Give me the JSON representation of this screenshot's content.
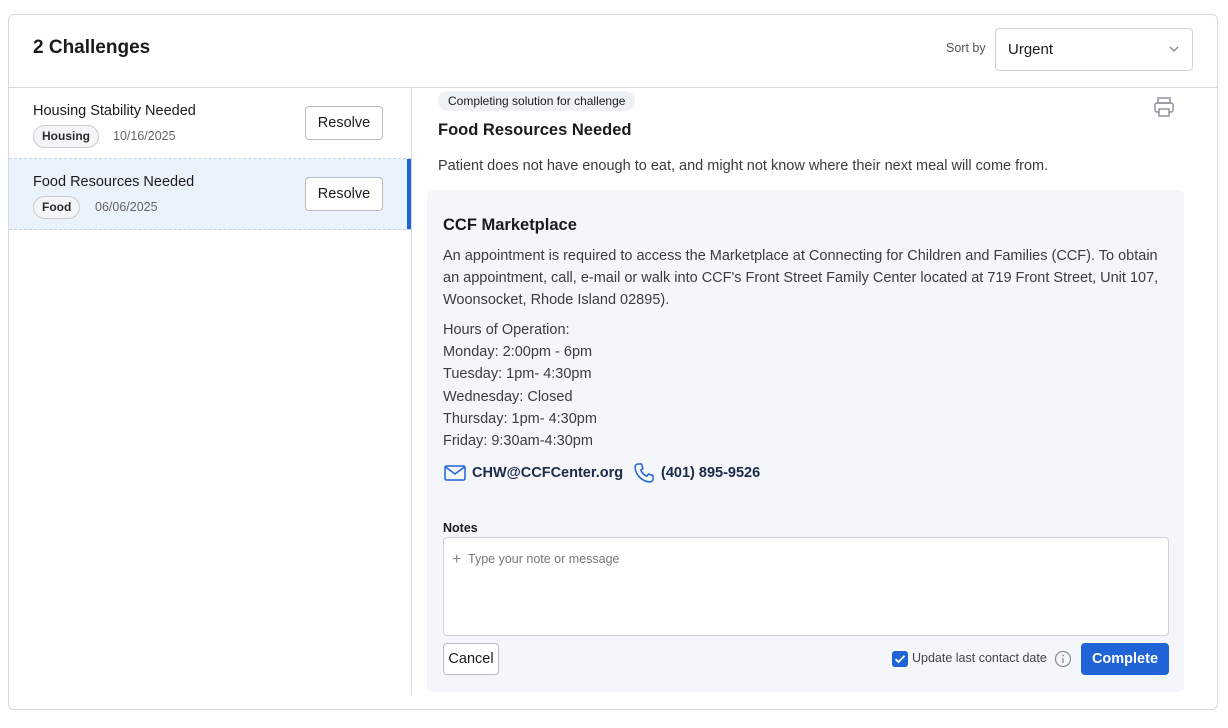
{
  "header": {
    "title": "2 Challenges",
    "sort_label": "Sort by",
    "sort_value": "Urgent"
  },
  "challenges": [
    {
      "title": "Housing Stability Needed",
      "tag": "Housing",
      "date": "10/16/2025",
      "action": "Resolve",
      "selected": false
    },
    {
      "title": "Food Resources Needed",
      "tag": "Food",
      "date": "06/06/2025",
      "action": "Resolve",
      "selected": true
    }
  ],
  "detail": {
    "badge": "Completing solution for challenge",
    "title": "Food Resources Needed",
    "description": "Patient does not have enough to eat, and might not know where their next meal will come from.",
    "resource": {
      "name": "CCF Marketplace",
      "description": "An appointment is required to access the Marketplace at Connecting for Children and Families (CCF). To obtain an appointment, call, e-mail or walk into CCF's Front Street Family Center located at 719 Front Street, Unit 107, Woonsocket, Rhode Island 02895).",
      "hours": [
        "Hours of Operation:",
        "Monday: 2:00pm - 6pm",
        "Tuesday: 1pm- 4:30pm",
        "Wednesday: Closed",
        "Thursday: 1pm- 4:30pm",
        "Friday: 9:30am-4:30pm"
      ],
      "email": "CHW@CCFCenter.org",
      "phone": "(401) 895-9526"
    },
    "notes": {
      "label": "Notes",
      "placeholder": "Type your note or message",
      "value": ""
    },
    "cancel_label": "Cancel",
    "checkbox_label": "Update last contact date",
    "checkbox_checked": true,
    "complete_label": "Complete"
  },
  "colors": {
    "accent": "#1f63d6",
    "selected_bg": "#eaf2fc",
    "card_bg": "#f4f6f9"
  }
}
